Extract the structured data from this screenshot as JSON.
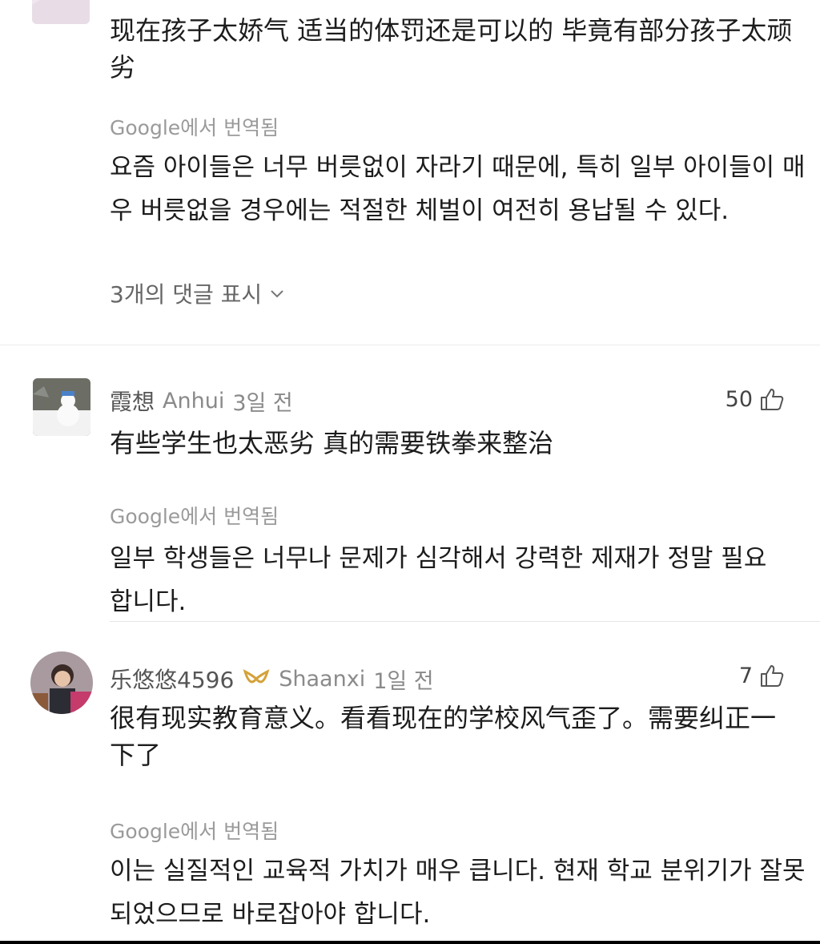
{
  "comments": [
    {
      "original": "现在孩子太娇气 适当的体罚还是可以的 毕竟有部分孩子太顽劣",
      "translated_label": "Google에서 번역됨",
      "translation": "요즘 아이들은 너무 버릇없이 자라기 때문에, 특히 일부 아이들이 매우 버릇없을 경우에는 적절한 체벌이 여전히 용납될 수 있다.",
      "show_replies": "3개의 댓글 표시"
    },
    {
      "name": "霞想",
      "location": "Anhui",
      "time": "3일 전",
      "likes": "50",
      "original": "有些学生也太恶劣 真的需要铁拳来整治",
      "translated_label": "Google에서 번역됨",
      "translation": "일부 학생들은 너무나 문제가 심각해서 강력한 제재가 정말 필요합니다."
    },
    {
      "name": "乐悠悠4596",
      "location": "Shaanxi",
      "time": "1일 전",
      "likes": "7",
      "original": "很有现实教育意义。看看现在的学校风气歪了。需要纠正一下了",
      "translated_label": "Google에서 번역됨",
      "translation": "이는 실질적인 교육적 가치가 매우 큽니다. 현재 학교 분위기가 잘못되었으므로 바로잡아야 합니다."
    }
  ],
  "icons": {
    "like": "thumbs-up-icon",
    "expand": "chevron-down-icon",
    "badge": "vip-badge-icon"
  },
  "colors": {
    "badge": "#d4a23a",
    "divider": "#e6e6e6"
  }
}
